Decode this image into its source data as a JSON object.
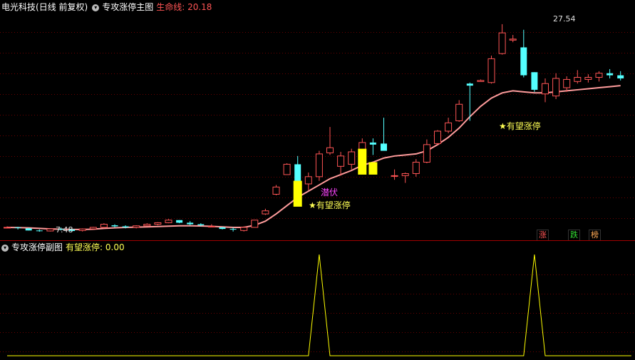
{
  "main_header": {
    "stock_name": "电光科技",
    "period": "(日线 前复权)",
    "indicator_name": "专攻涨停主图",
    "lifeline_label": "生命线: 20.18"
  },
  "sub_header": {
    "indicator_name": "专攻涨停副图",
    "value_label": "有望涨停: 0.00"
  },
  "annotations": {
    "high_price": "27.54",
    "low_price": "7.48",
    "hope_limit_up_1": "★有望涨停",
    "hope_limit_up_2": "★有望涨停",
    "ambush": "潜伏"
  },
  "tags": {
    "rise": "涨",
    "fall": "跌",
    "rank": "榜"
  },
  "colors": {
    "up": "#ff5555",
    "down": "#54ffff",
    "lifeline": "#ff9c9c",
    "signal": "#ffff00",
    "grid": "#6b0000",
    "text_red": "#ff5555",
    "text_yellow": "#ffff55",
    "text_magenta": "#ff44ff"
  },
  "icons": {
    "header_menu": "chevron-down-circle-icon"
  },
  "chart_data": [
    {
      "type": "candlestick",
      "title": "专攻涨停主图",
      "series": [
        {
          "name": "K线",
          "ohlc": [
            [
              7.9,
              8.0,
              7.8,
              7.9
            ],
            [
              7.9,
              7.95,
              7.7,
              7.85
            ],
            [
              7.8,
              7.85,
              7.6,
              7.6
            ],
            [
              7.6,
              7.7,
              7.48,
              7.55
            ],
            [
              7.55,
              7.8,
              7.5,
              7.75
            ],
            [
              7.75,
              7.9,
              7.6,
              7.7
            ],
            [
              7.7,
              7.8,
              7.5,
              7.55
            ],
            [
              7.6,
              7.8,
              7.5,
              7.75
            ],
            [
              7.75,
              7.95,
              7.7,
              7.9
            ],
            [
              7.9,
              8.3,
              7.8,
              8.2
            ],
            [
              8.1,
              8.2,
              7.9,
              8.0
            ],
            [
              8.0,
              8.1,
              7.8,
              7.9
            ],
            [
              7.9,
              8.1,
              7.8,
              8.05
            ],
            [
              8.05,
              8.3,
              8.0,
              8.2
            ],
            [
              8.2,
              8.4,
              8.1,
              8.35
            ],
            [
              8.35,
              8.7,
              8.3,
              8.6
            ],
            [
              8.6,
              8.6,
              8.3,
              8.35
            ],
            [
              8.35,
              8.5,
              8.1,
              8.2
            ],
            [
              8.2,
              8.3,
              8.0,
              8.1
            ],
            [
              8.0,
              8.2,
              7.9,
              8.0
            ],
            [
              7.9,
              7.95,
              7.7,
              7.75
            ],
            [
              7.75,
              7.9,
              7.5,
              7.7
            ],
            [
              7.6,
              8.0,
              7.5,
              7.9
            ],
            [
              7.9,
              8.6,
              7.9,
              8.6
            ],
            [
              9.2,
              9.7,
              9.1,
              9.5
            ],
            [
              11.1,
              12.0,
              11.0,
              11.8
            ],
            [
              13.0,
              14.1,
              13.0,
              14.0
            ],
            [
              14.0,
              14.8,
              12.1,
              12.3
            ],
            [
              12.1,
              13.2,
              11.5,
              12.8
            ],
            [
              12.8,
              15.3,
              12.4,
              15.0
            ],
            [
              15.1,
              17.6,
              14.9,
              15.6
            ],
            [
              13.8,
              15.2,
              12.9,
              14.8
            ],
            [
              14.0,
              15.5,
              13.5,
              15.2
            ],
            [
              15.4,
              16.5,
              15.3,
              16.1
            ],
            [
              16.1,
              16.5,
              14.9,
              15.9
            ],
            [
              16.0,
              18.5,
              15.6,
              15.3
            ],
            [
              12.9,
              13.5,
              12.5,
              12.9
            ],
            [
              12.9,
              13.2,
              12.2,
              13.1
            ],
            [
              13.1,
              14.5,
              12.8,
              14.2
            ],
            [
              14.2,
              16.4,
              14.1,
              15.9
            ],
            [
              16.0,
              17.3,
              15.9,
              17.2
            ],
            [
              17.2,
              18.5,
              17.0,
              18.0
            ],
            [
              18.2,
              20.2,
              18.1,
              19.8
            ],
            [
              21.8,
              21.9,
              18.2,
              21.6
            ],
            [
              22.0,
              22.2,
              22.0,
              22.1
            ],
            [
              21.9,
              24.5,
              21.8,
              24.2
            ],
            [
              24.7,
              27.54,
              24.6,
              26.7
            ],
            [
              26.0,
              26.5,
              25.8,
              26.1
            ],
            [
              25.3,
              27.0,
              22.4,
              22.6
            ],
            [
              22.9,
              22.9,
              21.0,
              21.2
            ],
            [
              20.8,
              22.3,
              20.0,
              21.8
            ],
            [
              20.6,
              22.8,
              20.3,
              22.3
            ],
            [
              21.4,
              22.5,
              21.0,
              22.2
            ],
            [
              22.0,
              23.1,
              21.8,
              22.4
            ],
            [
              22.2,
              22.7,
              21.9,
              22.4
            ],
            [
              22.4,
              23.0,
              22.0,
              22.8
            ],
            [
              22.8,
              23.2,
              22.3,
              22.6
            ],
            [
              22.6,
              23.0,
              22.1,
              22.3
            ]
          ]
        },
        {
          "name": "生命线",
          "values": [
            7.9,
            7.88,
            7.85,
            7.8,
            7.75,
            7.72,
            7.7,
            7.7,
            7.72,
            7.8,
            7.85,
            7.9,
            7.92,
            7.95,
            7.98,
            8.02,
            8.05,
            8.05,
            8.03,
            8.0,
            7.95,
            7.9,
            7.9,
            8.1,
            8.5,
            9.2,
            10.0,
            10.8,
            11.4,
            12.0,
            12.6,
            13.0,
            13.4,
            13.9,
            14.2,
            14.6,
            14.8,
            14.9,
            15.0,
            15.3,
            15.9,
            16.6,
            17.5,
            18.6,
            19.6,
            20.4,
            20.9,
            21.1,
            21.0,
            20.9,
            20.9,
            21.0,
            21.1,
            21.2,
            21.3,
            21.4,
            21.5,
            21.6
          ]
        }
      ],
      "ylim": [
        7.0,
        28.5
      ]
    },
    {
      "type": "line",
      "title": "专攻涨停副图",
      "series": [
        {
          "name": "有望涨停",
          "values": [
            0,
            0,
            0,
            0,
            0,
            0,
            0,
            0,
            0,
            0,
            0,
            0,
            0,
            0,
            0,
            0,
            0,
            0,
            0,
            0,
            0,
            0,
            0,
            0,
            0,
            0,
            0,
            0,
            0,
            1,
            0,
            0,
            0,
            0,
            0,
            0,
            0,
            0,
            0,
            0,
            0,
            0,
            0,
            0,
            0,
            0,
            0,
            0,
            0,
            1,
            0,
            0,
            0,
            0,
            0,
            0,
            0,
            0,
            0
          ]
        }
      ],
      "ylim": [
        0,
        1
      ]
    }
  ]
}
